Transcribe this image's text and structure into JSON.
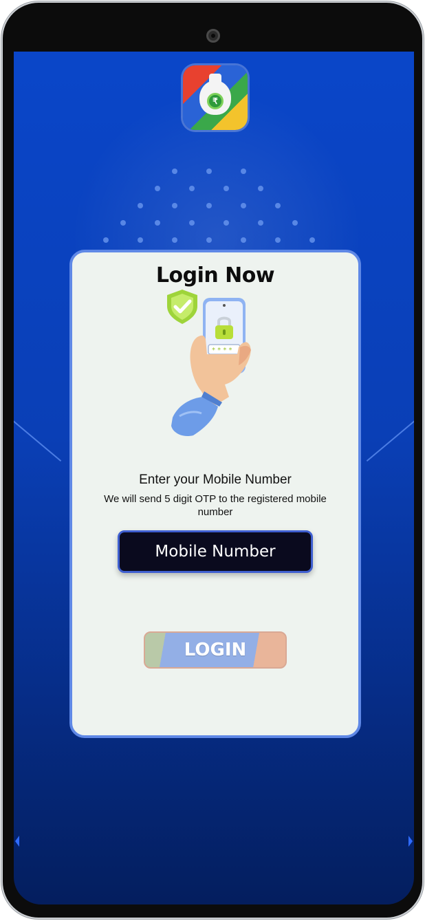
{
  "card": {
    "title": "Login Now",
    "enter_label": "Enter your Mobile Number",
    "otp_hint": "We will send 5 digit OTP to the registered mobile number"
  },
  "mobile_input": {
    "placeholder": "Mobile Number"
  },
  "login_button": {
    "label": "LOGIN"
  },
  "icons": {
    "app_icon": "money-bag-rupee-icon",
    "illustration": "hand-holding-phone-lock-icon",
    "shield": "shield-check-icon"
  },
  "colors": {
    "background": "#0a46c9",
    "card": "#eef3ef",
    "card_border": "#5f88e6",
    "input_bg": "#0a0a1e",
    "button_main": "#93afe6"
  }
}
